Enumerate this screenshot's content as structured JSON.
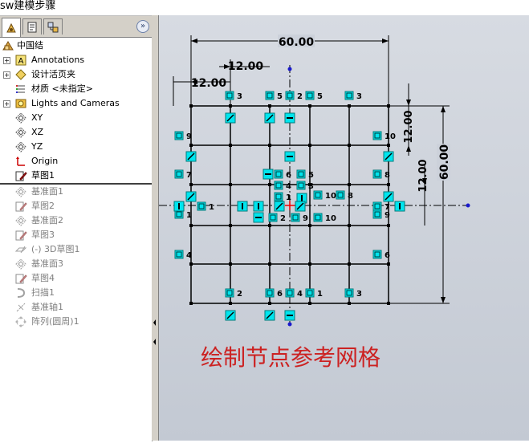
{
  "window": {
    "title": "sw建模步骤"
  },
  "panel": {
    "tabs": [
      {
        "icon": "feature-manager-icon"
      },
      {
        "icon": "property-manager-icon"
      },
      {
        "icon": "configuration-manager-icon"
      }
    ],
    "expand_symbol": "»",
    "tree": [
      {
        "label": "中国结",
        "icon": "part-icon",
        "expander": false,
        "dim": false
      },
      {
        "label": "Annotations",
        "icon": "annotations-icon",
        "expander": true,
        "dim": false
      },
      {
        "label": "设计活页夹",
        "icon": "design-binder-icon",
        "expander": true,
        "dim": false
      },
      {
        "label": "材质 <未指定>",
        "icon": "material-icon",
        "expander": false,
        "dim": false
      },
      {
        "label": "Lights and Cameras",
        "icon": "lights-icon",
        "expander": true,
        "dim": false
      },
      {
        "label": "XY",
        "icon": "plane-icon",
        "expander": false,
        "dim": false
      },
      {
        "label": "XZ",
        "icon": "plane-icon",
        "expander": false,
        "dim": false
      },
      {
        "label": "YZ",
        "icon": "plane-icon",
        "expander": false,
        "dim": false
      },
      {
        "label": "Origin",
        "icon": "origin-icon",
        "expander": false,
        "dim": false
      },
      {
        "label": "草图1",
        "icon": "sketch-icon",
        "expander": false,
        "dim": false
      },
      {
        "label": "基准面1",
        "icon": "plane-icon",
        "expander": false,
        "dim": true
      },
      {
        "label": "草图2",
        "icon": "sketch-icon",
        "expander": false,
        "dim": true
      },
      {
        "label": "基准面2",
        "icon": "plane-icon",
        "expander": false,
        "dim": true
      },
      {
        "label": "草图3",
        "icon": "sketch-icon",
        "expander": false,
        "dim": true
      },
      {
        "label": "(-) 3D草图1",
        "icon": "3d-sketch-icon",
        "expander": false,
        "dim": true
      },
      {
        "label": "基准面3",
        "icon": "plane-icon",
        "expander": false,
        "dim": true
      },
      {
        "label": "草图4",
        "icon": "sketch-icon",
        "expander": false,
        "dim": true
      },
      {
        "label": "扫描1",
        "icon": "sweep-icon",
        "expander": false,
        "dim": true
      },
      {
        "label": "基准轴1",
        "icon": "axis-icon",
        "expander": false,
        "dim": true
      },
      {
        "label": "阵列(圆周)1",
        "icon": "circular-pattern-icon",
        "expander": false,
        "dim": true
      }
    ]
  },
  "sketch": {
    "dimensions": {
      "width": "60.00",
      "height": "60.00",
      "offset_small_1": "12.00",
      "offset_small_2": "12.00",
      "offset_right_1": "12.00",
      "offset_right_2": "12.00"
    },
    "relation_labels": [
      "3",
      "5",
      "2",
      "5",
      "3",
      "9",
      "10",
      "6",
      "5",
      "4",
      "3",
      "1",
      "10",
      "8",
      "7",
      "8",
      "1",
      "7",
      "1",
      "9",
      "2",
      "9",
      "10",
      "4",
      "6",
      "2",
      "6",
      "4",
      "1"
    ],
    "annotation": "绘制节点参考网格",
    "annotation_color": "#cc2222",
    "line_color": "#000000",
    "marker_color": "#00e5ee"
  }
}
